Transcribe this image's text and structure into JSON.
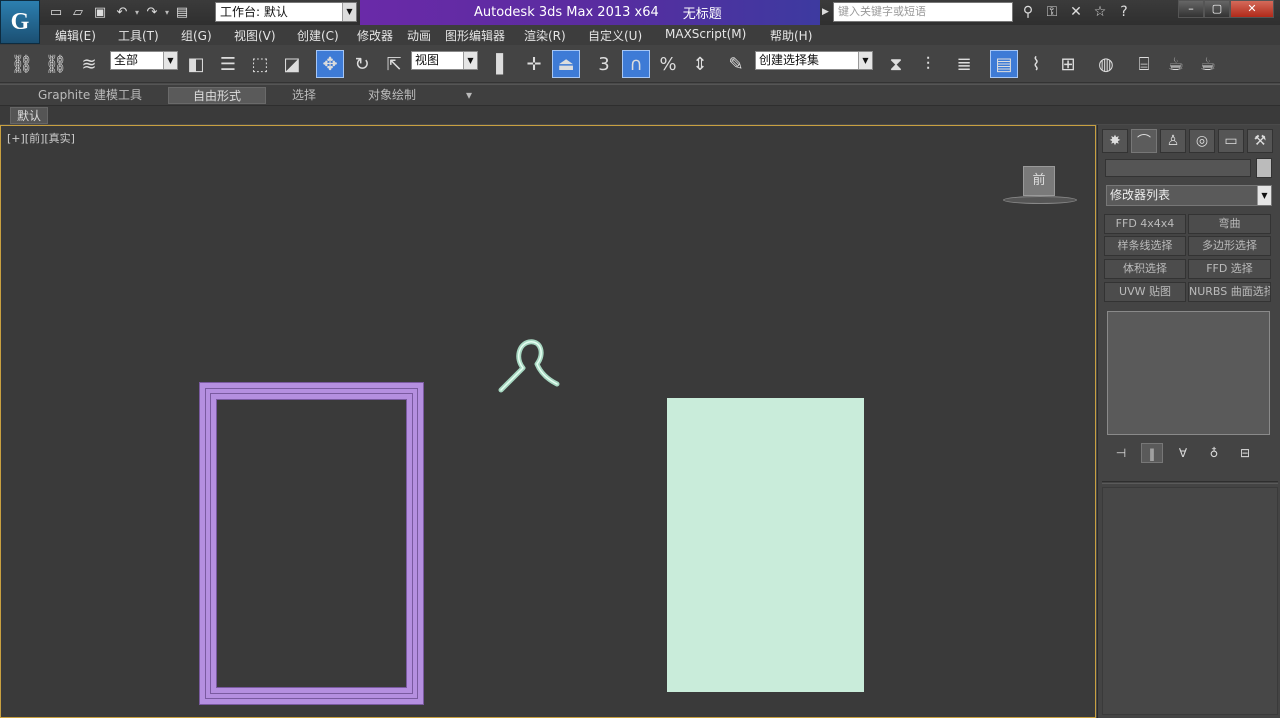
{
  "app": {
    "logo_glyph": "G",
    "workspace": "工作台: 默认",
    "title": "Autodesk 3ds Max  2013 x64",
    "document": "无标题",
    "search_placeholder": "键入关键字或短语"
  },
  "menu": [
    "编辑(E)",
    "工具(T)",
    "组(G)",
    "视图(V)",
    "创建(C)",
    "修改器",
    "动画",
    "图形编辑器",
    "渲染(R)",
    "自定义(U)",
    "MAXScript(M)",
    "帮助(H)"
  ],
  "toolbar": {
    "selection_filter": "全部",
    "reference_coord": "视图",
    "snap_label": "3",
    "named_selection": "创建选择集"
  },
  "ribbon": {
    "tabs": [
      "Graphite 建模工具",
      "自由形式",
      "选择",
      "对象绘制"
    ],
    "active_tab": "自由形式",
    "sub_tag": "默认"
  },
  "viewport": {
    "label": "[+][前][真实]",
    "viewcube_face": "前",
    "objects": {
      "frame_color": "#b58fe0",
      "panel_color": "#c9ecda",
      "hook_color": "#a8d8c2"
    }
  },
  "command_panel": {
    "modifier_list": "修改器列表",
    "modifier_buttons": [
      "FFD 4x4x4",
      "弯曲",
      "样条线选择",
      "多边形选择",
      "体积选择",
      "FFD 选择",
      "UVW 贴图",
      "NURBS 曲面选择"
    ]
  }
}
